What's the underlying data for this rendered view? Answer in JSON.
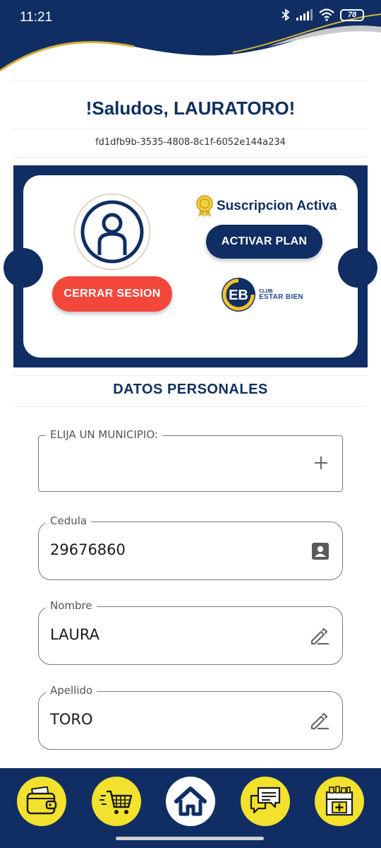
{
  "status_bar": {
    "time": "11:21",
    "battery": "78"
  },
  "header": {
    "greeting": "!Saludos, LAURATORO!",
    "user_id": "fd1dfb9b-3535-4808-8c1f-6052e144a234"
  },
  "profile_card": {
    "logout_label": "CERRAR SESION",
    "subscription_status": "Suscripcion Activa",
    "activate_label": "ACTIVAR PLAN",
    "club_logo_initials": "EB",
    "club_logo_small": "CLUB",
    "club_logo_name": "ESTAR BIEN"
  },
  "personal_data": {
    "section_title": "DATOS PERSONALES",
    "fields": [
      {
        "label": "ELIJA UN MUNICIPIO:",
        "value": "",
        "icon": "plus-icon"
      },
      {
        "label": "Cedula",
        "value": "29676860",
        "icon": "id-card-icon"
      },
      {
        "label": "Nombre",
        "value": "LAURA",
        "icon": "edit-icon"
      },
      {
        "label": "Apellido",
        "value": "TORO",
        "icon": "edit-icon"
      }
    ]
  },
  "bottom_nav": {
    "items": [
      {
        "icon": "wallet-icon"
      },
      {
        "icon": "cart-icon"
      },
      {
        "icon": "home-icon",
        "active": true
      },
      {
        "icon": "chat-icon"
      },
      {
        "icon": "pharmacy-icon"
      }
    ]
  },
  "colors": {
    "primary_navy": "#102e63",
    "logout_red": "#f2473a",
    "nav_yellow": "#f2e12d",
    "accent_gold": "#d4b23a"
  }
}
